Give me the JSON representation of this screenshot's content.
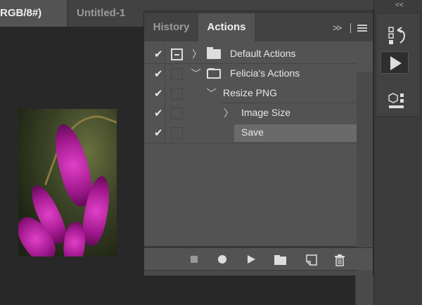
{
  "document_tabs": [
    {
      "label": "RGB/8#)"
    },
    {
      "label": "Untitled-1 @"
    }
  ],
  "panel": {
    "tabs": [
      {
        "label": "History"
      },
      {
        "label": "Actions"
      }
    ],
    "rows": [
      {
        "label": "Default Actions",
        "checked": true,
        "expanded": false,
        "type": "set"
      },
      {
        "label": "Felicia's Actions",
        "checked": true,
        "expanded": true,
        "type": "set"
      },
      {
        "label": "Resize PNG",
        "checked": true,
        "expanded": true,
        "type": "action"
      },
      {
        "label": "Image Size",
        "checked": true,
        "expanded": false,
        "type": "step"
      },
      {
        "label": "Save",
        "checked": true,
        "type": "step",
        "selected": true
      }
    ],
    "toolbar": [
      "stop-icon",
      "record-icon",
      "play-icon",
      "new-set-icon",
      "new-action-icon",
      "delete-icon"
    ]
  },
  "dock": {
    "collapse_label": "<<"
  },
  "colors": {
    "panel_bg": "#535353",
    "selected_row": "#6a6a6a",
    "canvas": "#282828"
  }
}
